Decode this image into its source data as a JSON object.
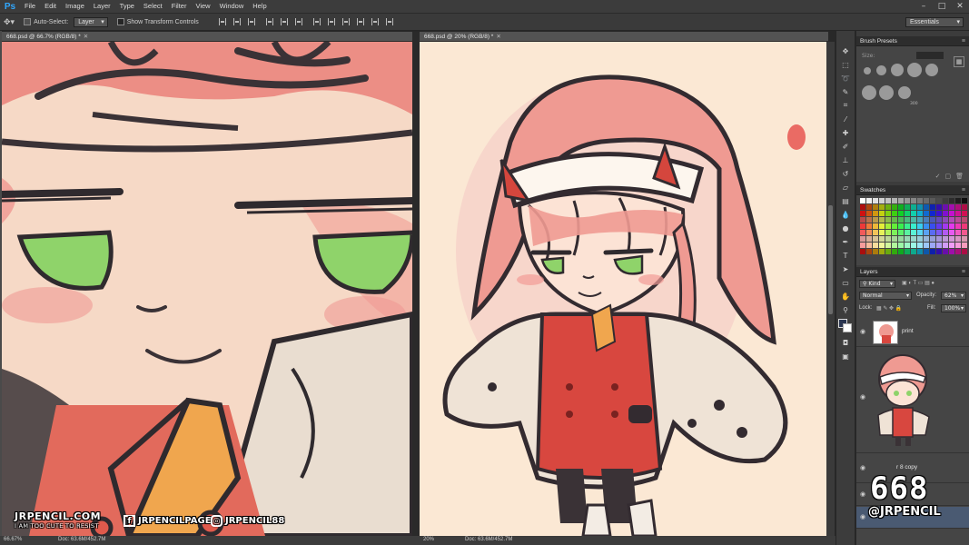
{
  "app": {
    "logo": "Ps"
  },
  "menu": [
    "File",
    "Edit",
    "Image",
    "Layer",
    "Type",
    "Select",
    "Filter",
    "View",
    "Window",
    "Help"
  ],
  "window_controls": [
    "–",
    "□",
    "✕"
  ],
  "options_bar": {
    "auto_select_label": "Auto-Select:",
    "auto_select_target": "Layer",
    "show_transform_label": "Show Transform Controls",
    "workspace": "Essentials"
  },
  "documents": [
    {
      "tab_title": "668.psd @ 66.7% (RGB/8) *",
      "zoom": "66.67%",
      "doc_size": "Doc: 63.6M/452.7M"
    },
    {
      "tab_title": "668.psd @ 20% (RGB/8) *",
      "zoom": "20%",
      "doc_size": "Doc: 63.6M/452.7M"
    }
  ],
  "panels": {
    "brush_presets": {
      "title": "Brush Presets",
      "size_label": "Size:",
      "sample_number": "300"
    },
    "swatches": {
      "title": "Swatches"
    },
    "layers": {
      "title": "Layers",
      "filter": "Kind",
      "blend_mode": "Normal",
      "opacity_label": "Opacity:",
      "opacity_value": "62%",
      "lock_label": "Lock:",
      "fill_label": "Fill:",
      "fill_value": "100%",
      "items": [
        {
          "name": "print"
        },
        {
          "name": ""
        },
        {
          "name": "r 8 copy"
        }
      ]
    }
  },
  "colors": {
    "foreground": "#2a3550",
    "background": "#ffffff",
    "canvas_bg": "#fbe8d4",
    "hair": "#ef9a92",
    "coat": "#d8473f",
    "eyes": "#8fd36a"
  },
  "watermark": {
    "site": "JRPENCIL.COM",
    "tagline": "I AM TOO CUTE TO RESIST",
    "facebook": "JRPENCILPAGE",
    "instagram": "JRPENCIL88",
    "number": "668",
    "handle": "@JRPENCIL"
  }
}
